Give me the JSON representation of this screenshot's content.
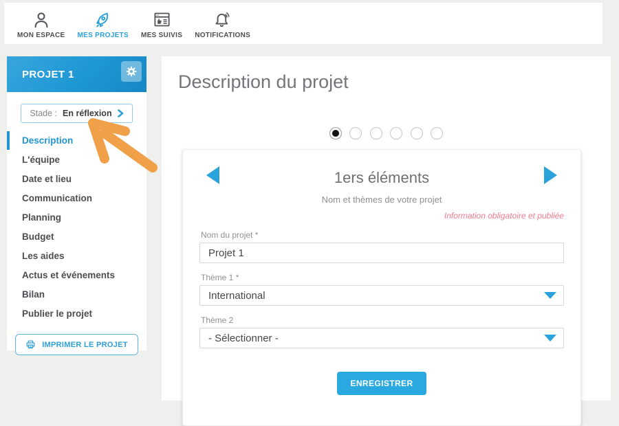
{
  "topnav": {
    "items": [
      {
        "label": "MON ESPACE"
      },
      {
        "label": "MES PROJETS"
      },
      {
        "label": "MES SUIVIS"
      },
      {
        "label": "NOTIFICATIONS"
      }
    ]
  },
  "sidebar": {
    "project_title": "PROJET 1",
    "stade_prefix": "Stade :",
    "stade_value": "En réflexion",
    "menu": [
      {
        "label": "Description",
        "active": true
      },
      {
        "label": "L'équipe",
        "active": false
      },
      {
        "label": "Date et lieu",
        "active": false
      },
      {
        "label": "Communication",
        "active": false
      },
      {
        "label": "Planning",
        "active": false
      },
      {
        "label": "Budget",
        "active": false
      },
      {
        "label": "Les aides",
        "active": false
      },
      {
        "label": "Actus et événements",
        "active": false
      },
      {
        "label": "Bilan",
        "active": false
      },
      {
        "label": "Publier le projet",
        "active": false
      }
    ],
    "print_button": "IMPRIMER LE PROJET"
  },
  "main": {
    "title": "Description du projet",
    "steps": {
      "total": 6,
      "current": 1
    },
    "card": {
      "title": "1ers éléments",
      "subtitle": "Nom et thèmes de votre projet",
      "note": "Information obligatoire et publiée",
      "fields": [
        {
          "label": "Nom du projet *",
          "type": "text",
          "value": "Projet 1"
        },
        {
          "label": "Thème 1 *",
          "type": "select",
          "value": "International"
        },
        {
          "label": "Thème 2",
          "type": "select",
          "value": "- Sélectionner -"
        }
      ],
      "submit_label": "ENREGISTRER"
    }
  },
  "colors": {
    "accent": "#29a3dc",
    "header_blue": "#1e97d4",
    "active_link": "#2196d3",
    "note_pink": "#f27b8e",
    "arrow_orange": "#f0a049"
  },
  "icons": {
    "gear": "gear-icon",
    "person": "person-icon",
    "rocket": "rocket-icon",
    "followed_pages": "browser-thumbs-up-icon",
    "bell": "bell-icon",
    "printer": "printer-icon",
    "chevron_right": "chevron-right-icon",
    "prev": "prev-arrow-icon",
    "next": "next-arrow-icon",
    "select_caret": "caret-down-icon",
    "hand_arrow": "hand-drawn-arrow"
  }
}
